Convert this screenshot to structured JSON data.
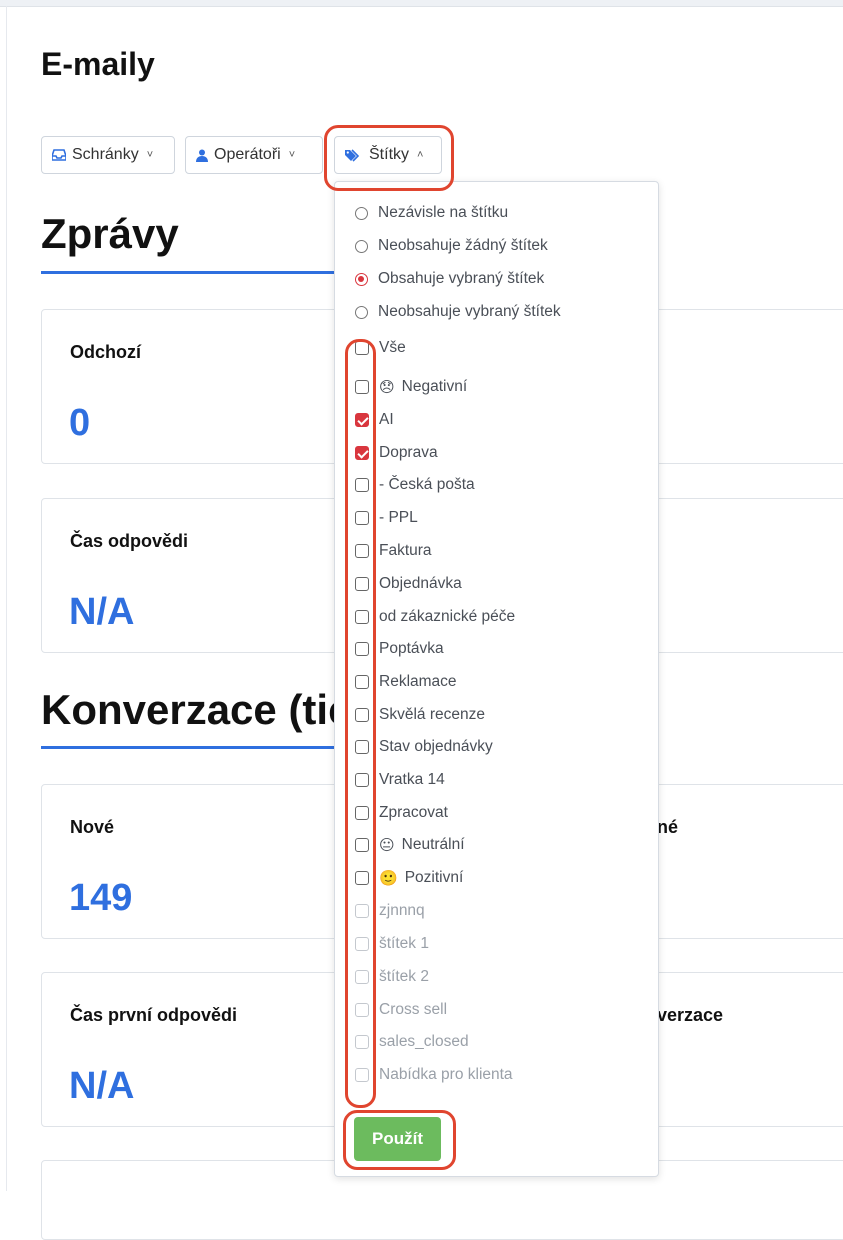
{
  "page": {
    "title": "E-maily"
  },
  "filters": [
    {
      "label": "Schránky",
      "icon": "inbox-icon",
      "chevron": "chevron-down"
    },
    {
      "label": "Operátoři",
      "icon": "user-icon",
      "chevron": "chevron-down"
    },
    {
      "label": "Štítky",
      "icon": "tags-icon",
      "chevron": "chevron-up"
    }
  ],
  "sections": [
    {
      "title": "Zprávy"
    },
    {
      "title": "Konverzace (tic"
    }
  ],
  "cards": [
    {
      "label": "Odchozí",
      "value": "0"
    },
    {
      "label": "Čas odpovědi",
      "value": "N/A"
    },
    {
      "label": "Nové",
      "value": "149",
      "right_fragment": "né"
    },
    {
      "label": "Čas první odpovědi",
      "value": "N/A",
      "right_fragment": "verzace"
    }
  ],
  "tag_filter": {
    "modes": [
      {
        "label": "Nezávisle na štítku",
        "selected": false
      },
      {
        "label": "Neobsahuje žádný štítek",
        "selected": false
      },
      {
        "label": "Obsahuje vybraný štítek",
        "selected": true
      },
      {
        "label": "Neobsahuje vybraný štítek",
        "selected": false
      }
    ],
    "tags": [
      {
        "label": "Vše",
        "checked": false,
        "dim": false,
        "emoji": ""
      },
      {
        "label": "Negativní",
        "checked": false,
        "dim": false,
        "emoji": "😞"
      },
      {
        "label": "AI",
        "checked": true,
        "dim": false,
        "emoji": ""
      },
      {
        "label": "Doprava",
        "checked": true,
        "dim": false,
        "emoji": ""
      },
      {
        "label": "- Česká pošta",
        "checked": false,
        "dim": false,
        "emoji": ""
      },
      {
        "label": "- PPL",
        "checked": false,
        "dim": false,
        "emoji": ""
      },
      {
        "label": "Faktura",
        "checked": false,
        "dim": false,
        "emoji": ""
      },
      {
        "label": "Objednávka",
        "checked": false,
        "dim": false,
        "emoji": ""
      },
      {
        "label": "od zákaznické péče",
        "checked": false,
        "dim": false,
        "emoji": ""
      },
      {
        "label": "Poptávka",
        "checked": false,
        "dim": false,
        "emoji": ""
      },
      {
        "label": "Reklamace",
        "checked": false,
        "dim": false,
        "emoji": ""
      },
      {
        "label": "Skvělá recenze",
        "checked": false,
        "dim": false,
        "emoji": ""
      },
      {
        "label": "Stav objednávky",
        "checked": false,
        "dim": false,
        "emoji": ""
      },
      {
        "label": "Vratka 14",
        "checked": false,
        "dim": false,
        "emoji": ""
      },
      {
        "label": "Zpracovat",
        "checked": false,
        "dim": false,
        "emoji": ""
      },
      {
        "label": "Neutrální",
        "checked": false,
        "dim": false,
        "emoji": "😐"
      },
      {
        "label": "Pozitivní",
        "checked": false,
        "dim": false,
        "emoji": "🙂"
      },
      {
        "label": "zjnnnq",
        "checked": false,
        "dim": true,
        "emoji": ""
      },
      {
        "label": "štítek 1",
        "checked": false,
        "dim": true,
        "emoji": ""
      },
      {
        "label": "štítek 2",
        "checked": false,
        "dim": true,
        "emoji": ""
      },
      {
        "label": "Cross sell",
        "checked": false,
        "dim": true,
        "emoji": ""
      },
      {
        "label": "sales_closed",
        "checked": false,
        "dim": true,
        "emoji": ""
      },
      {
        "label": "Nabídka pro klienta",
        "checked": false,
        "dim": true,
        "emoji": ""
      }
    ],
    "apply_label": "Použít"
  },
  "colors": {
    "accent": "#2f6fdf",
    "checked": "#d9363e",
    "apply": "#6cbb5e",
    "highlight": "#e0452f"
  }
}
